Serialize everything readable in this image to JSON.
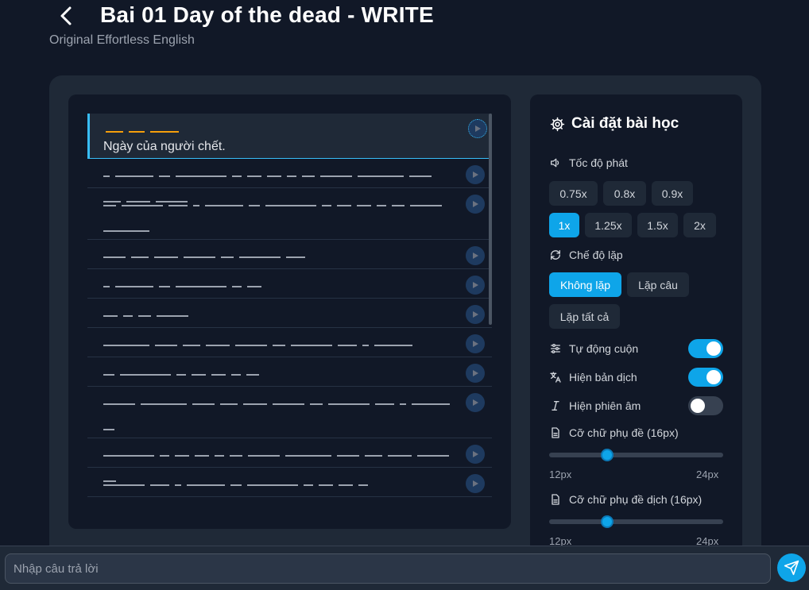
{
  "header": {
    "title": "Bai 01 Day of the dead - WRITE",
    "subtitle": "Original Effortless English"
  },
  "sentences": [
    {
      "state": "active",
      "translation": "Ngày của người chết.",
      "word_count": 3
    },
    {
      "state": "hidden",
      "word_count": 15
    },
    {
      "state": "hidden",
      "word_count": 14
    },
    {
      "state": "hidden",
      "word_count": 7
    },
    {
      "state": "hidden",
      "word_count": 6
    },
    {
      "state": "hidden",
      "word_count": 4
    },
    {
      "state": "hidden",
      "word_count": 10
    },
    {
      "state": "hidden",
      "word_count": 7
    },
    {
      "state": "hidden",
      "word_count": 12
    },
    {
      "state": "hidden",
      "word_count": 13
    },
    {
      "state": "hidden",
      "word_count": 10
    }
  ],
  "settings": {
    "title": "Cài đặt bài học",
    "speed": {
      "label": "Tốc độ phát",
      "options": [
        "0.75x",
        "0.8x",
        "0.9x",
        "1x",
        "1.25x",
        "1.5x",
        "2x"
      ],
      "selected": "1x"
    },
    "repeat": {
      "label": "Chế độ lặp",
      "options": [
        "Không lặp",
        "Lặp câu",
        "Lặp tất cả"
      ],
      "selected": "Không lặp"
    },
    "auto_scroll": {
      "label": "Tự động cuộn",
      "on": true
    },
    "show_translation": {
      "label": "Hiện bản dịch",
      "on": true
    },
    "show_phonetic": {
      "label": "Hiện phiên âm",
      "on": false
    },
    "subtitle_size": {
      "label": "Cỡ chữ phụ đề (16px)",
      "min_label": "12px",
      "max_label": "24px",
      "value": 16,
      "min": 12,
      "max": 24
    },
    "translation_size": {
      "label": "Cỡ chữ phụ đề dịch (16px)",
      "min_label": "12px",
      "max_label": "24px",
      "value": 16,
      "min": 12,
      "max": 24
    }
  },
  "answer": {
    "placeholder": "Nhập câu trả lời",
    "value": ""
  },
  "colors": {
    "accent": "#0ea5e9",
    "active_blank": "#f59e0b",
    "background": "#111827"
  }
}
